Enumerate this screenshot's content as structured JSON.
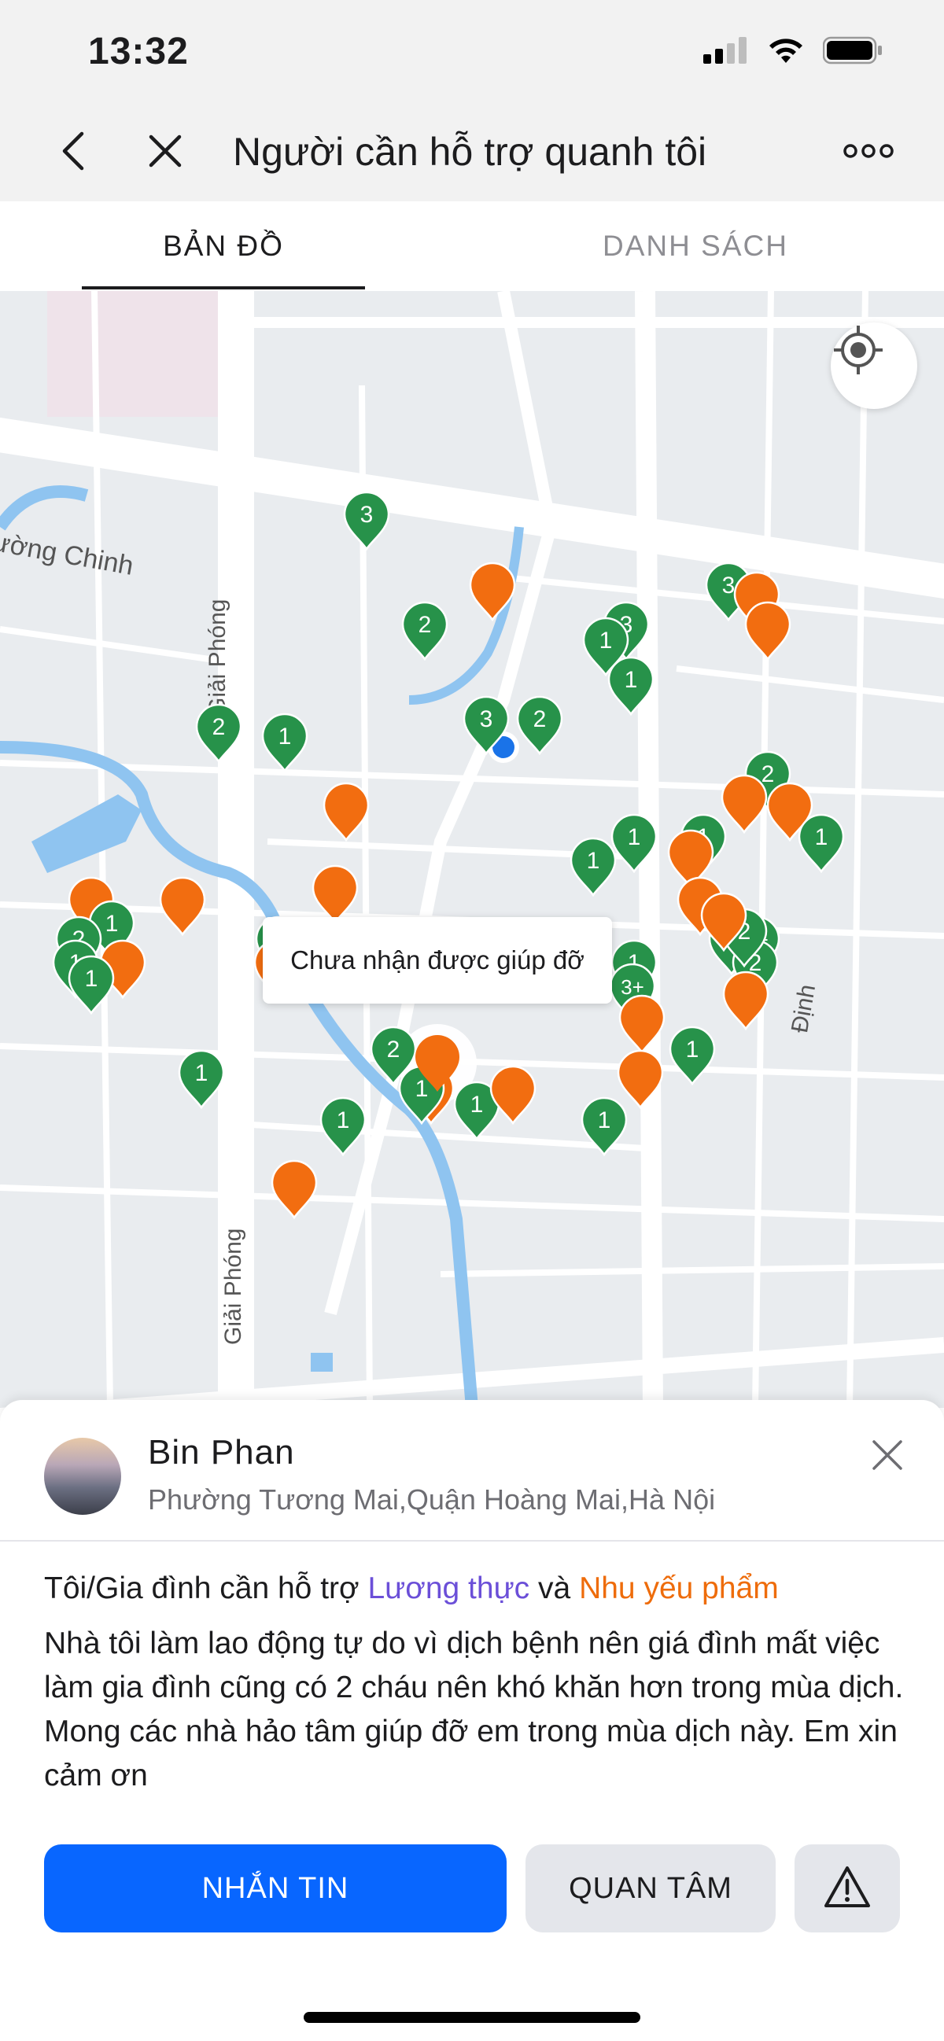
{
  "status_bar": {
    "time": "13:32"
  },
  "header": {
    "title": "Người cần hỗ trợ quanh tôi",
    "back_icon": "chevron-left-icon",
    "close_icon": "close-icon",
    "more_icon": "more-horizontal-icon"
  },
  "tabs": [
    {
      "label": "BẢN ĐỒ",
      "active": true
    },
    {
      "label": "DANH SÁCH",
      "active": false
    }
  ],
  "map": {
    "street_labels": [
      "ường Chinh",
      "Giải Phóng",
      "Giải Phóng",
      "Định"
    ],
    "tooltip": "Chưa nhận được giúp đỡ",
    "locate_icon": "locate-icon",
    "colors": {
      "green_marker": "#27924a",
      "orange_marker": "#f26d10",
      "water": "#8fc4f0",
      "road": "#ffffff"
    },
    "markers": [
      {
        "color": "green",
        "label": "3"
      },
      {
        "color": "orange",
        "label": ""
      },
      {
        "color": "green",
        "label": "2"
      },
      {
        "color": "green",
        "label": "3"
      },
      {
        "color": "green",
        "label": "1"
      },
      {
        "color": "green",
        "label": "1"
      },
      {
        "color": "green",
        "label": "3"
      },
      {
        "color": "orange",
        "label": ""
      },
      {
        "color": "orange",
        "label": ""
      },
      {
        "color": "green",
        "label": "2"
      },
      {
        "color": "green",
        "label": "1"
      },
      {
        "color": "green",
        "label": "3"
      },
      {
        "color": "green",
        "label": "2"
      },
      {
        "color": "orange",
        "label": ""
      },
      {
        "color": "green",
        "label": "2"
      },
      {
        "color": "orange",
        "label": ""
      },
      {
        "color": "orange",
        "label": ""
      },
      {
        "color": "green",
        "label": "1"
      },
      {
        "color": "green",
        "label": "1"
      },
      {
        "color": "green",
        "label": "1"
      },
      {
        "color": "orange",
        "label": ""
      },
      {
        "color": "green",
        "label": "1"
      },
      {
        "color": "orange",
        "label": ""
      },
      {
        "color": "orange",
        "label": ""
      },
      {
        "color": "orange",
        "label": ""
      },
      {
        "color": "green",
        "label": "1"
      },
      {
        "color": "green",
        "label": "2"
      },
      {
        "color": "green",
        "label": "1"
      },
      {
        "color": "orange",
        "label": ""
      },
      {
        "color": "green",
        "label": "1"
      },
      {
        "color": "green",
        "label": "2"
      },
      {
        "color": "orange",
        "label": ""
      },
      {
        "color": "orange",
        "label": ""
      },
      {
        "color": "orange",
        "label": ""
      },
      {
        "color": "green",
        "label": "1"
      },
      {
        "color": "green",
        "label": "3+"
      },
      {
        "color": "orange",
        "label": ""
      },
      {
        "color": "green",
        "label": "1"
      },
      {
        "color": "green",
        "label": "3+"
      },
      {
        "color": "green",
        "label": "2"
      },
      {
        "color": "orange",
        "label": ""
      },
      {
        "color": "green",
        "label": "2"
      },
      {
        "color": "orange",
        "label": ""
      },
      {
        "color": "orange",
        "label": ""
      },
      {
        "color": "green",
        "label": "1"
      },
      {
        "color": "green",
        "label": "1"
      },
      {
        "color": "green",
        "label": "2"
      },
      {
        "color": "orange",
        "label": ""
      },
      {
        "color": "green",
        "label": "1"
      },
      {
        "color": "green",
        "label": "1"
      },
      {
        "color": "orange",
        "label": ""
      },
      {
        "color": "green",
        "label": "1"
      },
      {
        "color": "green",
        "label": "1"
      },
      {
        "color": "orange",
        "label": ""
      },
      {
        "color": "orange",
        "label": ""
      }
    ]
  },
  "person": {
    "name": "Bin Phan",
    "address": "Phường Tương Mai,Quận Hoàng Mai,Hà Nội",
    "need_prefix": "Tôi/Gia đình cần hỗ trợ",
    "need_item_1": "Lương thực",
    "need_connector": "và",
    "need_item_2": "Nhu yếu phẩm",
    "description": "Nhà tôi làm lao động tự do vì dịch bệnh nên giá đình mất việc làm gia đình cũng có 2 cháu nên khó khăn hơn trong mùa dịch. Mong các nhà hảo tâm giúp đỡ em trong mùa dịch này. Em xin cảm ơn",
    "close_icon": "close-icon"
  },
  "actions": {
    "message_label": "NHẮN TIN",
    "care_label": "QUAN TÂM",
    "report_icon": "warning-icon"
  },
  "colors": {
    "primary": "#0866ff",
    "food": "#6b4fd8",
    "supplies": "#ee6c0b"
  }
}
